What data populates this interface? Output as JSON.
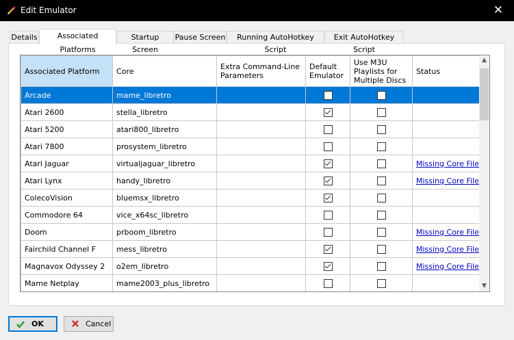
{
  "window": {
    "title": "Edit Emulator",
    "close_glyph": "✕",
    "icon": "pencil-icon"
  },
  "tabs": [
    {
      "label": "Details"
    },
    {
      "label": "Associated Platforms"
    },
    {
      "label": "Startup Screen"
    },
    {
      "label": "Pause Screen"
    },
    {
      "label": "Running AutoHotkey Script"
    },
    {
      "label": "Exit AutoHotkey Script"
    }
  ],
  "active_tab": "Associated Platforms",
  "table": {
    "columns": [
      {
        "label": "Associated Platform"
      },
      {
        "label": "Core"
      },
      {
        "label": "Extra Command-Line Parameters"
      },
      {
        "label": "Default Emulator"
      },
      {
        "label": "Use M3U Playlists for Multiple Discs"
      },
      {
        "label": "Status"
      }
    ],
    "rows": [
      {
        "platform": "Arcade",
        "core": "mame_libretro",
        "params": "",
        "default": false,
        "m3u": false,
        "status": "",
        "selected": true
      },
      {
        "platform": "Atari 2600",
        "core": "stella_libretro",
        "params": "",
        "default": true,
        "m3u": false,
        "status": ""
      },
      {
        "platform": "Atari 5200",
        "core": "atari800_libretro",
        "params": "",
        "default": false,
        "m3u": false,
        "status": ""
      },
      {
        "platform": "Atari 7800",
        "core": "prosystem_libretro",
        "params": "",
        "default": false,
        "m3u": false,
        "status": ""
      },
      {
        "platform": "Atari Jaguar",
        "core": "virtualjaguar_libretro",
        "params": "",
        "default": true,
        "m3u": false,
        "status": "Missing Core File"
      },
      {
        "platform": "Atari Lynx",
        "core": "handy_libretro",
        "params": "",
        "default": true,
        "m3u": false,
        "status": "Missing Core File"
      },
      {
        "platform": "ColecoVision",
        "core": "bluemsx_libretro",
        "params": "",
        "default": true,
        "m3u": false,
        "status": ""
      },
      {
        "platform": "Commodore 64",
        "core": "vice_x64sc_libretro",
        "params": "",
        "default": false,
        "m3u": false,
        "status": ""
      },
      {
        "platform": "Doom",
        "core": "prboom_libretro",
        "params": "",
        "default": false,
        "m3u": false,
        "status": "Missing Core File"
      },
      {
        "platform": "Fairchild Channel F",
        "core": "mess_libretro",
        "params": "",
        "default": true,
        "m3u": false,
        "status": "Missing Core File"
      },
      {
        "platform": "Magnavox Odyssey 2",
        "core": "o2em_libretro",
        "params": "",
        "default": true,
        "m3u": false,
        "status": "Missing Core File"
      },
      {
        "platform": "Mame Netplay",
        "core": "mame2003_plus_libretro",
        "params": "",
        "default": false,
        "m3u": false,
        "status": ""
      }
    ]
  },
  "buttons": {
    "ok": "OK",
    "cancel": "Cancel"
  },
  "colors": {
    "selection": "#0078d7",
    "sorted_header": "#c4e1f7",
    "link": "#0000c0",
    "titlebar": "#000000"
  }
}
